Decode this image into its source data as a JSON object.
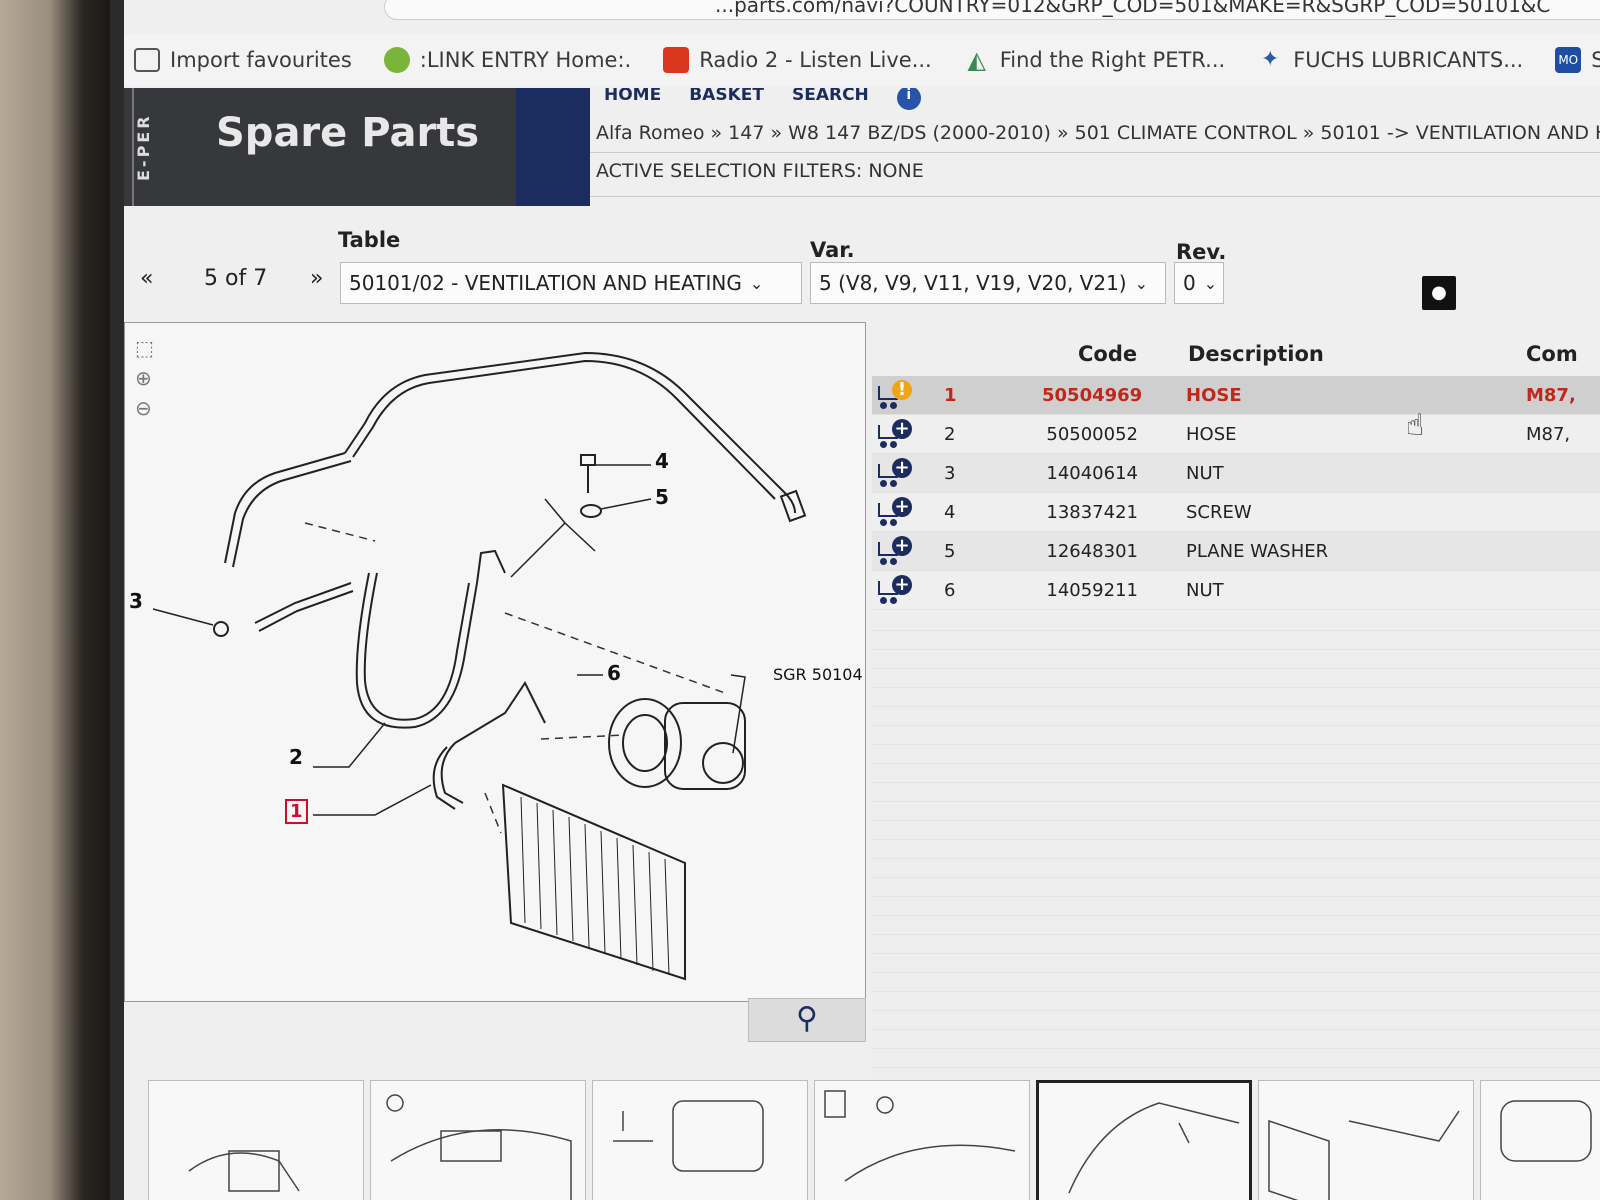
{
  "browser": {
    "url": "...parts.com/navi?COUNTRY=012&GRP_COD=501&MAKE=R&SGRP_COD=50101&C",
    "bookmarks": [
      {
        "label": "Import favourites",
        "icon": "import-icon"
      },
      {
        "label": ":LINK ENTRY Home:.",
        "icon": "link-entry-icon"
      },
      {
        "label": "Radio 2 - Listen Live...",
        "icon": "radio-icon"
      },
      {
        "label": "Find the Right PETR...",
        "icon": "find-petrol-icon"
      },
      {
        "label": "FUCHS LUBRICANTS...",
        "icon": "fuchs-icon"
      },
      {
        "label": "Sign",
        "icon": "mo-icon",
        "badge": "MO"
      }
    ]
  },
  "header": {
    "brand_side": "E-PER",
    "title": "Spare Parts",
    "nav": [
      "HOME",
      "BASKET",
      "SEARCH"
    ],
    "info_icon": "i"
  },
  "breadcrumb": "Alfa Romeo » 147 » W8 147 BZ/DS (2000-2010) » 501 CLIMATE CONTROL » 50101 -> VENTILATION AND H",
  "filters": "ACTIVE SELECTION FILTERS: NONE",
  "selectors": {
    "table_label": "Table",
    "var_label": "Var.",
    "rev_label": "Rev.",
    "prev": "«",
    "next": "»",
    "page": "5 of 7",
    "table_value": "50101/02 - VENTILATION AND HEATING",
    "var_value": "5 (V8, V9, V11, V19, V20, V21)",
    "rev_value": "0"
  },
  "diagram": {
    "callouts": [
      "1",
      "2",
      "3",
      "4",
      "5",
      "6"
    ],
    "reference": "SGR 50104"
  },
  "parts_table": {
    "headers": {
      "code": "Code",
      "description": "Description",
      "com": "Com"
    },
    "rows": [
      {
        "num": "1",
        "code": "50504969",
        "description": "HOSE",
        "com": "M87,",
        "status": "warning",
        "selected": true
      },
      {
        "num": "2",
        "code": "50500052",
        "description": "HOSE",
        "com": "M87,",
        "status": "add"
      },
      {
        "num": "3",
        "code": "14040614",
        "description": "NUT",
        "com": "",
        "status": "add"
      },
      {
        "num": "4",
        "code": "13837421",
        "description": "SCREW",
        "com": "",
        "status": "add"
      },
      {
        "num": "5",
        "code": "12648301",
        "description": "PLANE WASHER",
        "com": "",
        "status": "add"
      },
      {
        "num": "6",
        "code": "14059211",
        "description": "NUT",
        "com": "",
        "status": "add"
      }
    ]
  },
  "colors": {
    "brand_dark": "#36383c",
    "brand_blue": "#1b2d5e",
    "selected_text": "#c0281b"
  }
}
